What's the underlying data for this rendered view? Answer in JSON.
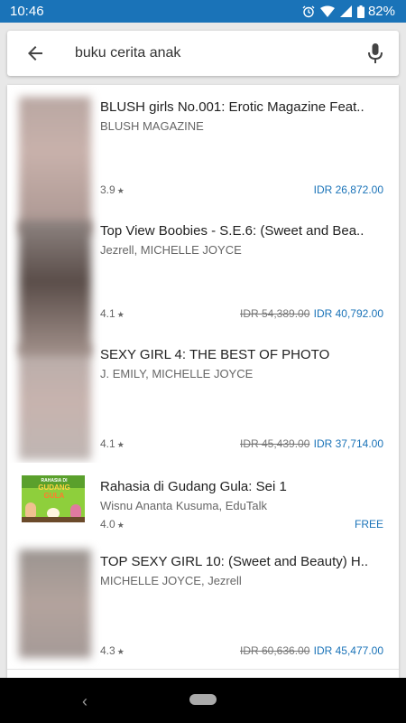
{
  "status_bar": {
    "time": "10:46",
    "battery": "82%",
    "icons": [
      "alarm-icon",
      "wifi-icon",
      "signal-icon",
      "battery-icon"
    ]
  },
  "search": {
    "query": "buku cerita anak"
  },
  "results": [
    {
      "title": "BLUSH girls No.001: Erotic Magazine Feat..",
      "author": "BLUSH MAGAZINE",
      "rating": "3.9",
      "old_price": "",
      "price": "IDR 26,872.00"
    },
    {
      "title": "Top View Boobies - S.E.6: (Sweet and Bea..",
      "author": "Jezrell, MICHELLE JOYCE",
      "rating": "4.1",
      "old_price": "IDR 54,389.00",
      "price": "IDR 40,792.00"
    },
    {
      "title": "SEXY GIRL 4: THE BEST OF PHOTO",
      "author": "J. EMILY, MICHELLE JOYCE",
      "rating": "4.1",
      "old_price": "IDR 45,439.00",
      "price": "IDR 37,714.00"
    },
    {
      "title": "Rahasia di Gudang Gula: Sei 1",
      "author": "Wisnu Ananta Kusuma, EduTalk",
      "rating": "4.0",
      "old_price": "",
      "price": "FREE",
      "cover_text": [
        "RAHASIA DI",
        "GUDANG",
        "GULA"
      ]
    },
    {
      "title": "TOP SEXY GIRL 10: (Sweet and Beauty) H..",
      "author": "MICHELLE JOYCE, Jezrell",
      "rating": "4.3",
      "old_price": "IDR 60,636.00",
      "price": "IDR 45,477.00"
    }
  ],
  "colors": {
    "status_bar": "#1a73b8",
    "price": "#1a73b8",
    "background": "#e8e8e8"
  }
}
